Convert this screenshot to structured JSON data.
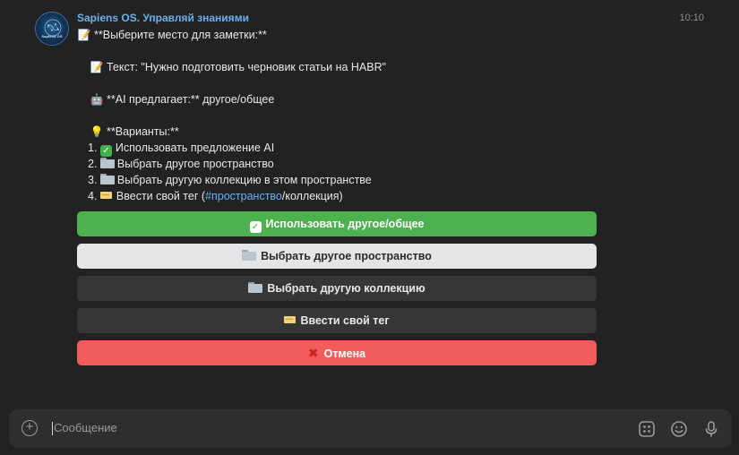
{
  "bot": {
    "name": "Sapiens OS. Управляй знаниями",
    "avatar_text": "Sapiens OS",
    "time": "10:10"
  },
  "message": {
    "title": "**Выберите место для заметки:**",
    "text_line": "Текст: \"Нужно подготовить черновик статьи на HABR\"",
    "ai_line": "**AI предлагает:** другое/общее",
    "variants_title": "**Варианты:**",
    "options": [
      {
        "num": "1.",
        "label": "Использовать предложение AI"
      },
      {
        "num": "2.",
        "label": "Выбрать другое пространство"
      },
      {
        "num": "3.",
        "label": "Выбрать другую коллекцию в этом пространстве"
      },
      {
        "num": "4.",
        "label_prefix": "Ввести свой тег (",
        "hashtag": "#пространство",
        "label_suffix": "/коллекция)"
      }
    ]
  },
  "buttons": {
    "use_ai": "Использовать другое/общее",
    "other_space": "Выбрать другое пространство",
    "other_collection": "Выбрать другую коллекцию",
    "own_tag": "Ввести свой тег",
    "cancel": "Отмена"
  },
  "composer": {
    "placeholder": "Сообщение"
  },
  "icons": {
    "memo": "memo-icon",
    "robot": "robot-icon",
    "bulb": "lightbulb-icon",
    "check": "check-mark-icon",
    "folder": "folder-icon",
    "tag": "label-tag-icon",
    "cross": "cross-mark-icon",
    "attach": "plus-circle-icon",
    "apps": "bot-commands-icon",
    "emoji": "emoji-icon",
    "mic": "microphone-icon"
  },
  "colors": {
    "background": "#222222",
    "accent_link": "#6ab1f0",
    "button_green": "#4cb14e",
    "button_light": "#e5e5e8",
    "button_dark": "#363636",
    "button_red": "#f25c5c"
  }
}
